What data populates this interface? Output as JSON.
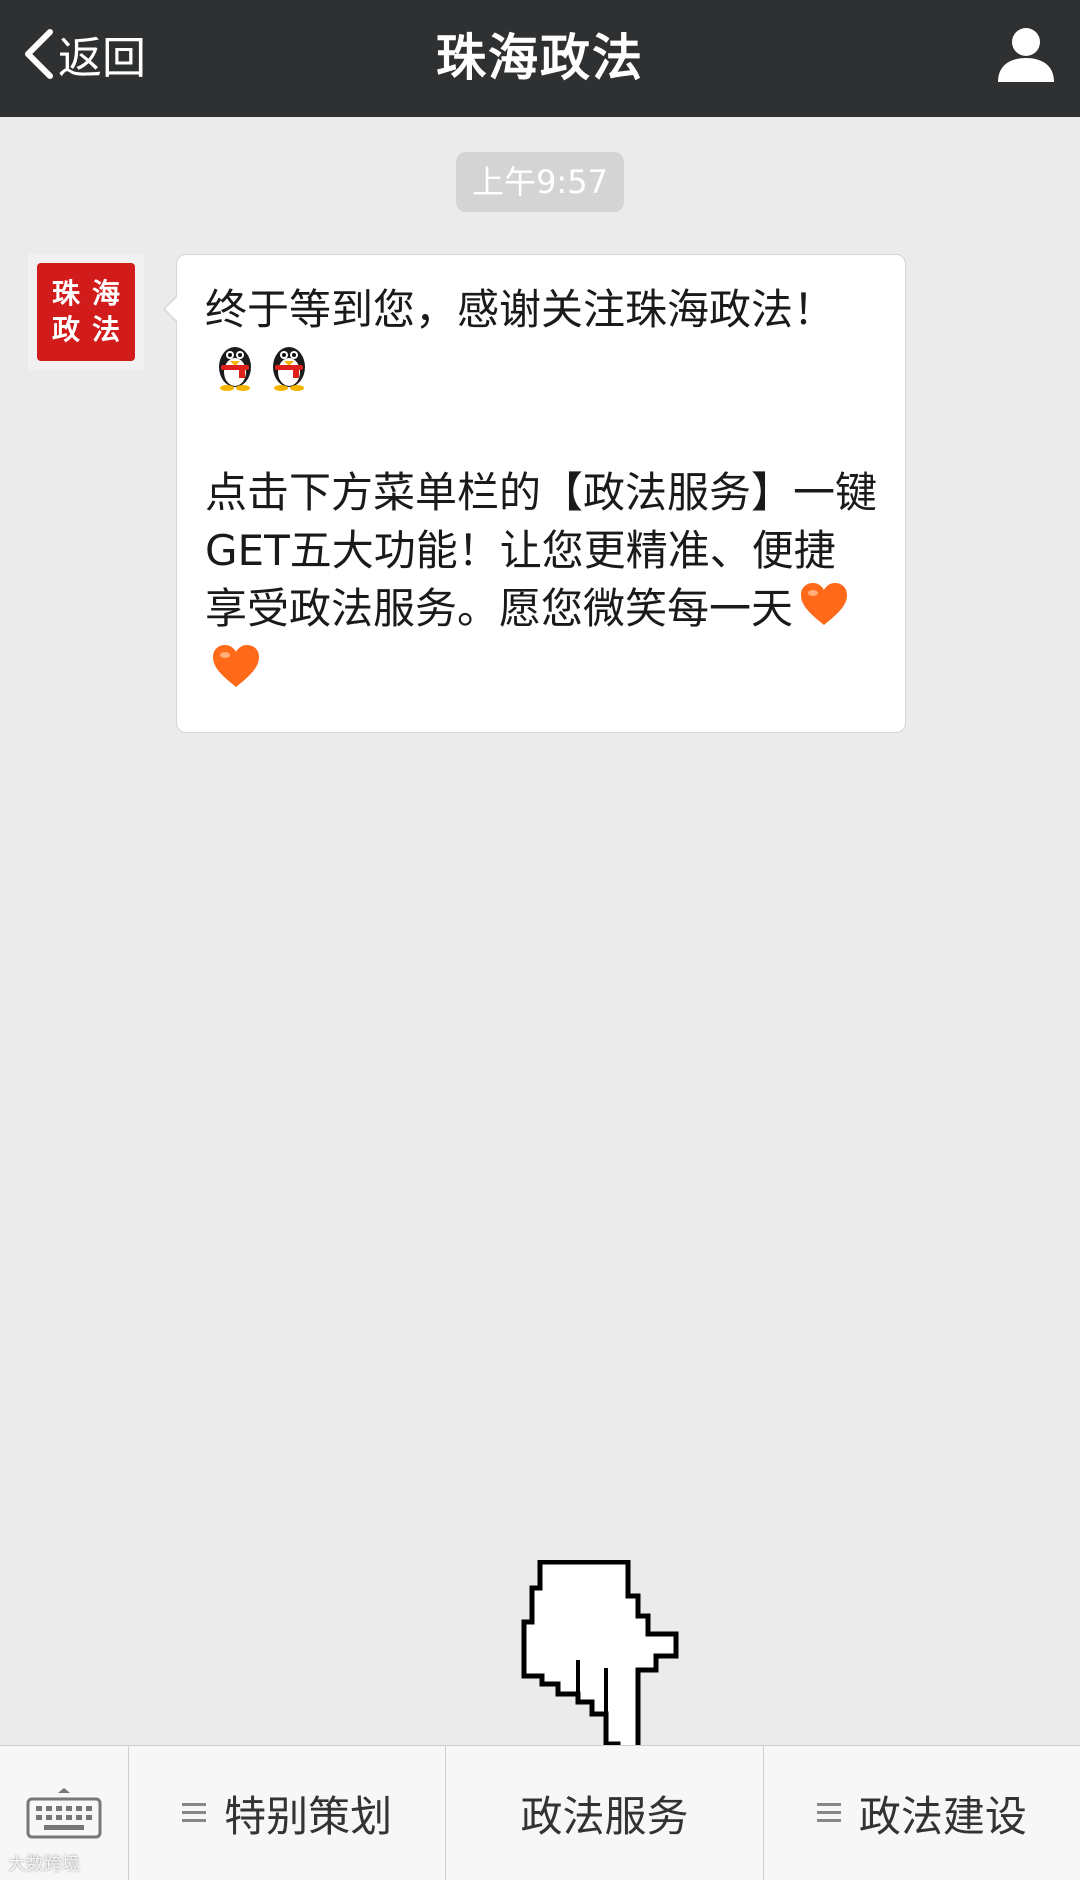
{
  "nav": {
    "back_label": "返回",
    "title": "珠海政法"
  },
  "chat": {
    "timestamp": "上午9:57",
    "avatar_seal": [
      "珠",
      "海",
      "政",
      "法"
    ],
    "message": {
      "paragraph1_text": "终于等到您，感谢关注珠海政法！",
      "paragraph1_emoji": [
        "penguin-icon",
        "penguin-icon"
      ],
      "paragraph2_text": "点击下方菜单栏的【政法服务】一键GET五大功能！让您更精准、便捷享受政法服务。愿您微笑每一天",
      "paragraph2_emoji": [
        "orange-heart-icon",
        "orange-heart-icon"
      ]
    }
  },
  "menu": {
    "items": [
      {
        "label": "特别策划",
        "has_submenu": true
      },
      {
        "label": "政法服务",
        "has_submenu": false
      },
      {
        "label": "政法建设",
        "has_submenu": true
      }
    ]
  },
  "watermark": "大数跨境",
  "colors": {
    "nav_bg": "#2e3032",
    "chat_bg": "#ebebeb",
    "seal_red": "#d21c1c",
    "heart": "#ff6a1a"
  }
}
